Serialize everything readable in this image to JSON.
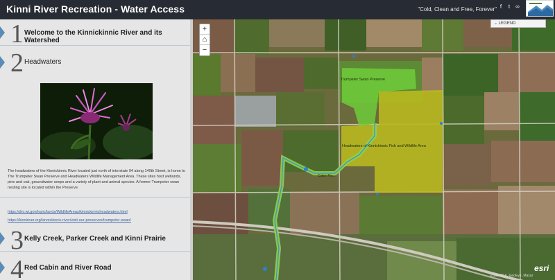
{
  "header": {
    "title": "Kinni River Recreation - Water Access",
    "tagline": "\"Cold, Clean and Free, Forever\"",
    "social": [
      "f",
      "t",
      "🔗"
    ]
  },
  "sidebar": {
    "sections": [
      {
        "number": "1",
        "title": "Welcome to the Kinnickinnic River and its Watershed"
      },
      {
        "number": "2",
        "title": "Headwaters",
        "body": "The headwaters of the Kinnickinnic River located just north of interstate 94 along 140th Street, is home to The Trumpeter Swan Preserve and Headwaters Wildlife Management Area. These sites host wetlands, pine and oak, groundwater seeps and a variety of plant and animal species. A former Trumpeter swan nesting site is located within the Preserve.",
        "link1": "https://dnr.wi.gov/topic/lands/WildlifeAreas/kinnickinnicheadwaters.html",
        "link2": "https://kinniriver.org/kinnickinnic-river/visit-our-preserves/trumpeter-swan/"
      },
      {
        "number": "3",
        "title": "Kelly Creek, Parker Creek and Kinni Prairie"
      },
      {
        "number": "4",
        "title": "Red Cabin and River Road"
      }
    ]
  },
  "map": {
    "zoom_in": "+",
    "home": "⌂",
    "zoom_out": "−",
    "legend_label": "LEGEND",
    "legend_chevron": "⌄",
    "labels": {
      "swan_preserve": "Trumpeter Swan Preserve",
      "wildlife_area": "Headwaters of Kinnickinnic Fish and Wildlife Area",
      "lake": "Cake Pa..."
    },
    "attribution": "USDA FSA, GeoEye, Maxar",
    "esri_logo": "esri",
    "colors": {
      "swan_preserve": "#6ecb3a",
      "wildlife_area": "#b8b81f",
      "river": "#8fd14f"
    }
  }
}
